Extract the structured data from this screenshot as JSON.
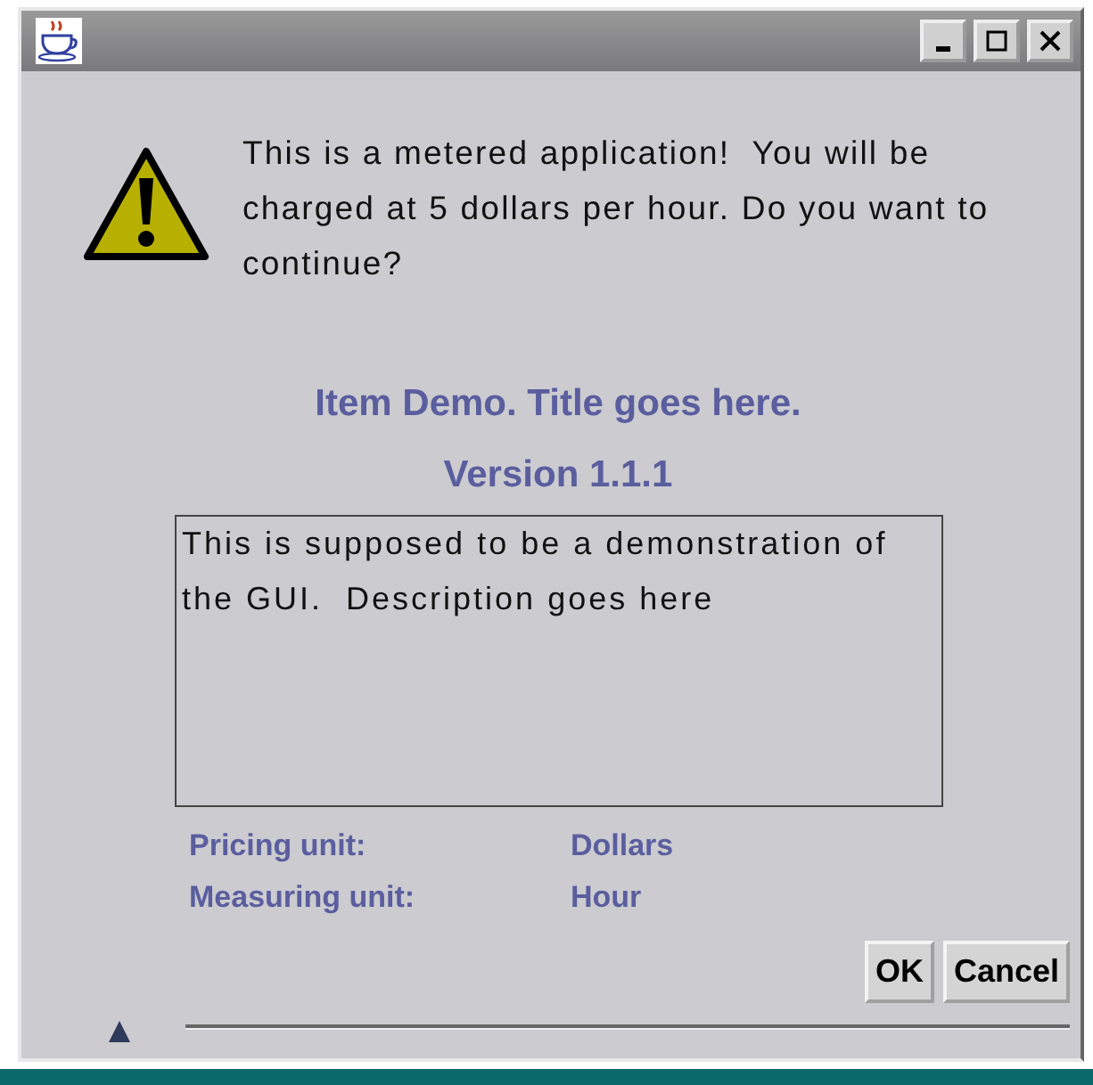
{
  "message": "This is a metered application!  You will be charged at 5 dollars per hour. Do you want to continue?",
  "title": "Item Demo.  Title goes here.",
  "version": "Version 1.1.1",
  "description": "This is supposed to be a demonstration of the GUI.  Description goes here",
  "fields": [
    {
      "label": "Pricing unit:",
      "value": "Dollars"
    },
    {
      "label": "Measuring unit:",
      "value": "Hour"
    }
  ],
  "buttons": [
    "OK",
    "Cancel"
  ]
}
